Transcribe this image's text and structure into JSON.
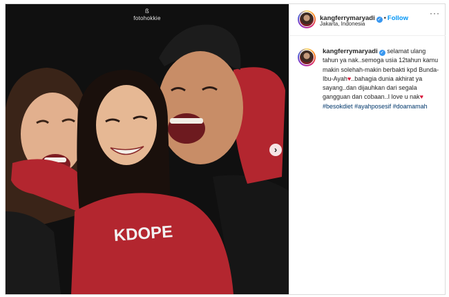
{
  "photo": {
    "watermark_icon": "logo-glyph",
    "watermark_text": "fotohokkie",
    "shirt_text": "KDOPE",
    "shirt_color": "#b3262f",
    "background_color": "#0f0f0f",
    "next_icon": "chevron-right-icon",
    "next_glyph": "›"
  },
  "header": {
    "username": "kangferrymaryadi",
    "verified_glyph": "✓",
    "separator": "•",
    "follow_label": "Follow",
    "location": "Jakarta, Indonesia",
    "more_glyph": "···"
  },
  "caption": {
    "username": "kangferrymaryadi",
    "verified_glyph": "✓",
    "text_1": "selamat ulang tahun ya nak..semoga usia 12tahun kamu makin solehah-makin berbakti kpd Bunda-Ibu-Ayah",
    "heart_glyph": "♥",
    "text_2": "..bahagia dunia akhirat ya sayang..dan dijauhkan dari segala gangguan dan cobaan..I love u nak",
    "hashtags": [
      "#besokdiet",
      "#ayahposesif",
      "#doamamah"
    ]
  },
  "colors": {
    "follow_blue": "#0095f6",
    "verified_blue": "#3897f0",
    "hashtag_blue": "#00376b",
    "heart_red": "#d81b3c"
  }
}
